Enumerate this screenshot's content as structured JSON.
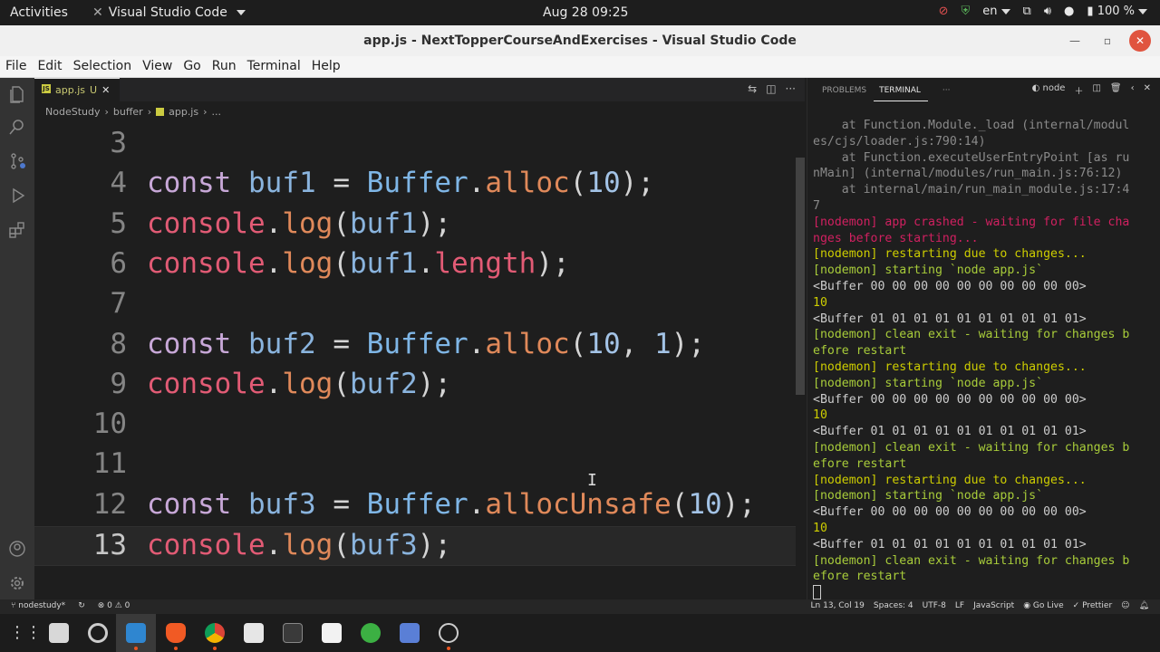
{
  "topbar": {
    "activities": "Activities",
    "app_name": "Visual Studio Code",
    "clock": "Aug 28  09:25",
    "lang": "en",
    "battery": "100 %"
  },
  "window": {
    "title": "app.js - NextTopperCourseAndExercises - Visual Studio Code"
  },
  "menu": [
    "File",
    "Edit",
    "Selection",
    "View",
    "Go",
    "Run",
    "Terminal",
    "Help"
  ],
  "editor": {
    "tab_label": "app.js",
    "tab_modified": "U",
    "breadcrumb": [
      "NodeStudy",
      "buffer",
      "app.js",
      "..."
    ],
    "lines": [
      {
        "n": "3",
        "tokens": []
      },
      {
        "n": "4",
        "tokens": [
          [
            "kw",
            "const"
          ],
          [
            "p",
            " "
          ],
          [
            "var",
            "buf1"
          ],
          [
            "p",
            " "
          ],
          [
            "op",
            "="
          ],
          [
            "p",
            " "
          ],
          [
            "cls",
            "Buffer"
          ],
          [
            "p",
            "."
          ],
          [
            "fn",
            "alloc"
          ],
          [
            "p",
            "("
          ],
          [
            "num",
            "10"
          ],
          [
            "p",
            ");"
          ]
        ]
      },
      {
        "n": "5",
        "tokens": [
          [
            "obj",
            "console"
          ],
          [
            "p",
            "."
          ],
          [
            "fn",
            "log"
          ],
          [
            "p",
            "("
          ],
          [
            "var",
            "buf1"
          ],
          [
            "p",
            ");"
          ]
        ]
      },
      {
        "n": "6",
        "tokens": [
          [
            "obj",
            "console"
          ],
          [
            "p",
            "."
          ],
          [
            "fn",
            "log"
          ],
          [
            "p",
            "("
          ],
          [
            "var",
            "buf1"
          ],
          [
            "p",
            "."
          ],
          [
            "prop",
            "length"
          ],
          [
            "p",
            ");"
          ]
        ]
      },
      {
        "n": "7",
        "tokens": []
      },
      {
        "n": "8",
        "tokens": [
          [
            "kw",
            "const"
          ],
          [
            "p",
            " "
          ],
          [
            "var",
            "buf2"
          ],
          [
            "p",
            " "
          ],
          [
            "op",
            "="
          ],
          [
            "p",
            " "
          ],
          [
            "cls",
            "Buffer"
          ],
          [
            "p",
            "."
          ],
          [
            "fn",
            "alloc"
          ],
          [
            "p",
            "("
          ],
          [
            "num",
            "10"
          ],
          [
            "p",
            ", "
          ],
          [
            "num",
            "1"
          ],
          [
            "p",
            ");"
          ]
        ]
      },
      {
        "n": "9",
        "tokens": [
          [
            "obj",
            "console"
          ],
          [
            "p",
            "."
          ],
          [
            "fn",
            "log"
          ],
          [
            "p",
            "("
          ],
          [
            "var",
            "buf2"
          ],
          [
            "p",
            ");"
          ]
        ]
      },
      {
        "n": "10",
        "tokens": []
      },
      {
        "n": "11",
        "tokens": []
      },
      {
        "n": "12",
        "tokens": [
          [
            "kw",
            "const"
          ],
          [
            "p",
            " "
          ],
          [
            "var",
            "buf3"
          ],
          [
            "p",
            " "
          ],
          [
            "op",
            "="
          ],
          [
            "p",
            " "
          ],
          [
            "cls",
            "Buffer"
          ],
          [
            "p",
            "."
          ],
          [
            "fn",
            "allocUnsafe"
          ],
          [
            "p",
            "("
          ],
          [
            "num",
            "10"
          ],
          [
            "p",
            ");"
          ]
        ]
      },
      {
        "n": "13",
        "tokens": [
          [
            "obj",
            "console"
          ],
          [
            "p",
            "."
          ],
          [
            "fn",
            "log"
          ],
          [
            "p",
            "("
          ],
          [
            "var",
            "buf3"
          ],
          [
            "p",
            ");"
          ]
        ]
      }
    ],
    "current_line": "13",
    "token_colors": {
      "kw": "#c8a8d8",
      "var": "#8ab4de",
      "op": "#d4d4d4",
      "cls": "#7fb6e6",
      "fn": "#e0895a",
      "num": "#a3c3e6",
      "p": "#d4d4d4",
      "obj": "#e25b75",
      "prop": "#e25b75"
    }
  },
  "panel": {
    "tabs": [
      "PROBLEMS",
      "TERMINAL",
      "···"
    ],
    "active_tab": "TERMINAL",
    "shell": "node",
    "terminal_lines": [
      {
        "c": "dim",
        "t": "    at Function.Module._load (internal/modul"
      },
      {
        "c": "dim",
        "t": "es/cjs/loader.js:790:14)"
      },
      {
        "c": "dim",
        "t": "    at Function.executeUserEntryPoint [as ru"
      },
      {
        "c": "dim",
        "t": "nMain] (internal/modules/run_main.js:76:12)"
      },
      {
        "c": "dim",
        "t": "    at internal/main/run_main_module.js:17:4"
      },
      {
        "c": "dim",
        "t": "7"
      },
      {
        "c": "red",
        "t": "[nodemon] app crashed - waiting for file cha"
      },
      {
        "c": "red",
        "t": "nges before starting..."
      },
      {
        "c": "yellow",
        "t": "[nodemon] restarting due to changes..."
      },
      {
        "c": "green",
        "t": "[nodemon] starting `node app.js`"
      },
      {
        "c": "",
        "t": "<Buffer 00 00 00 00 00 00 00 00 00 00>"
      },
      {
        "c": "yellow",
        "t": "10"
      },
      {
        "c": "",
        "t": "<Buffer 01 01 01 01 01 01 01 01 01 01>"
      },
      {
        "c": "green",
        "t": "[nodemon] clean exit - waiting for changes b"
      },
      {
        "c": "green",
        "t": "efore restart"
      },
      {
        "c": "yellow",
        "t": "[nodemon] restarting due to changes..."
      },
      {
        "c": "green",
        "t": "[nodemon] starting `node app.js`"
      },
      {
        "c": "",
        "t": "<Buffer 00 00 00 00 00 00 00 00 00 00>"
      },
      {
        "c": "yellow",
        "t": "10"
      },
      {
        "c": "",
        "t": "<Buffer 01 01 01 01 01 01 01 01 01 01>"
      },
      {
        "c": "green",
        "t": "[nodemon] clean exit - waiting for changes b"
      },
      {
        "c": "green",
        "t": "efore restart"
      },
      {
        "c": "yellow",
        "t": "[nodemon] restarting due to changes..."
      },
      {
        "c": "green",
        "t": "[nodemon] starting `node app.js`"
      },
      {
        "c": "",
        "t": "<Buffer 00 00 00 00 00 00 00 00 00 00>"
      },
      {
        "c": "yellow",
        "t": "10"
      },
      {
        "c": "",
        "t": "<Buffer 01 01 01 01 01 01 01 01 01 01>"
      },
      {
        "c": "green",
        "t": "[nodemon] clean exit - waiting for changes b"
      },
      {
        "c": "green",
        "t": "efore restart"
      }
    ]
  },
  "statusbar": {
    "branch": "nodestudy*",
    "errors": "0",
    "warnings": "0",
    "position": "Ln 13, Col 19",
    "spaces": "Spaces: 4",
    "encoding": "UTF-8",
    "eol": "LF",
    "language": "JavaScript",
    "golive": "Go Live",
    "prettier": "Prettier"
  }
}
